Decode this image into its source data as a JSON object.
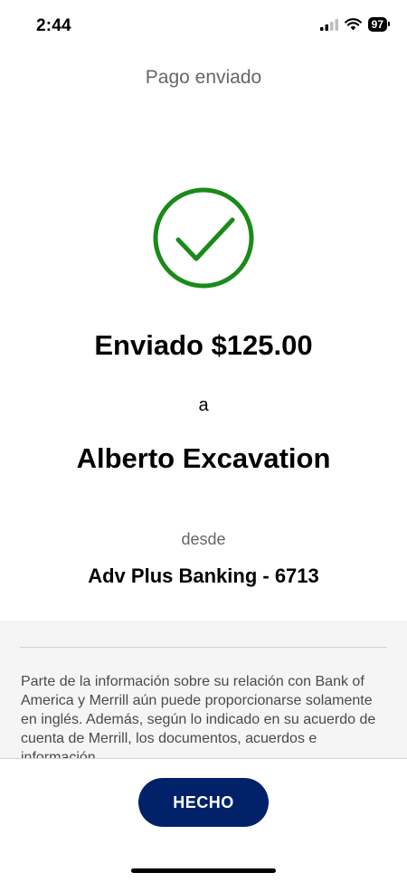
{
  "status_bar": {
    "time": "2:44",
    "battery_level": "97",
    "signal_icon": "cellular-signal-icon",
    "wifi_icon": "wifi-icon"
  },
  "nav": {
    "title": "Pago enviado"
  },
  "confirmation": {
    "icon": "success-check-icon",
    "accent_color": "#1a8a1a",
    "headline": "Enviado $125.00",
    "to_label": "a",
    "recipient": "Alberto Excavation",
    "from_label": "desde",
    "account": "Adv Plus Banking - 6713"
  },
  "disclosure": {
    "text": "Parte de la información sobre su relación con Bank of America y Merrill aún puede proporcionarse solamente en inglés. Además, según lo indicado en su acuerdo de cuenta de Merrill, los documentos, acuerdos e información"
  },
  "footer": {
    "done_label": "HECHO",
    "button_color": "#012169"
  }
}
